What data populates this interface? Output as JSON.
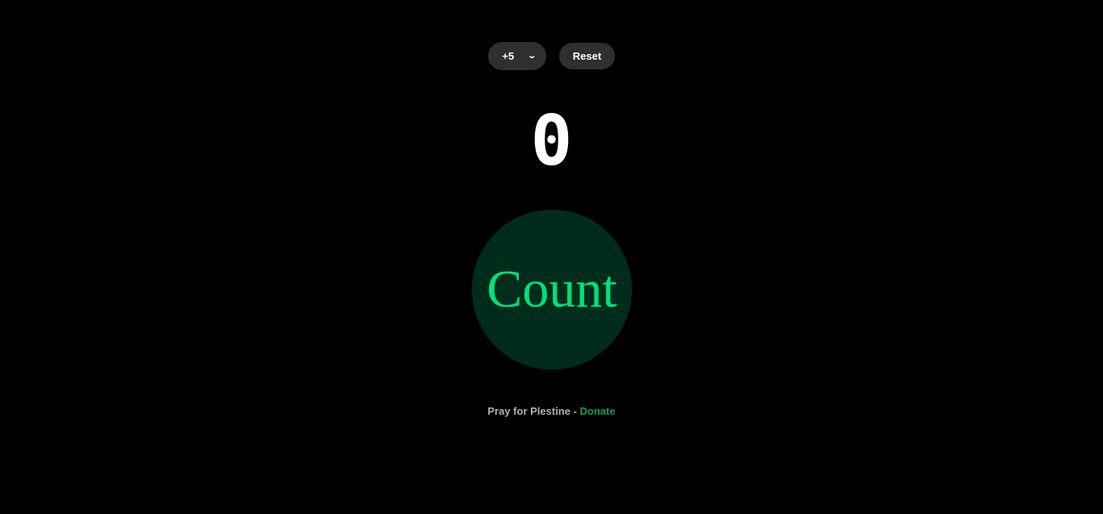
{
  "controls": {
    "step_select": {
      "selected": "+5",
      "icon": "chevron-down-icon"
    },
    "reset_label": "Reset"
  },
  "counter": {
    "value": "0"
  },
  "count_button": {
    "label": "Count"
  },
  "footer": {
    "text": "Pray for Plestine",
    "separator": " - ",
    "link_label": "Donate"
  },
  "colors": {
    "background": "#000000",
    "button_bg": "#2f2f2f",
    "count_bg": "#002d1b",
    "count_text": "#00e07a",
    "link": "#0f9d58"
  }
}
